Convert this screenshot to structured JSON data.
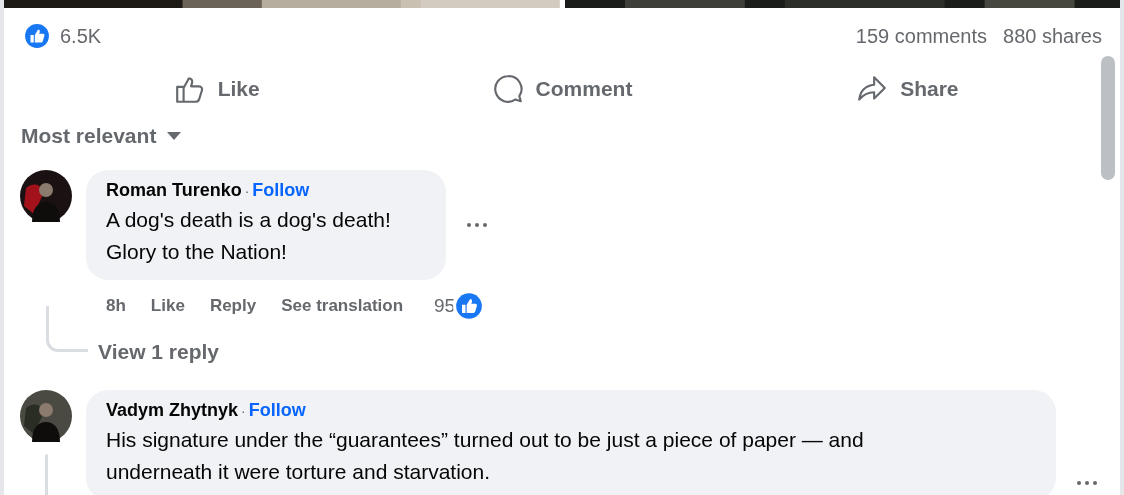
{
  "stats": {
    "reactions": "6.5K",
    "comments": "159 comments",
    "shares": "880 shares"
  },
  "actions": [
    {
      "kind": "like",
      "label": "Like"
    },
    {
      "kind": "comment",
      "label": "Comment"
    },
    {
      "kind": "share",
      "label": "Share"
    }
  ],
  "sort": {
    "label": "Most relevant"
  },
  "comments": [
    {
      "author": "Roman Turenko",
      "separator": "·",
      "follow": "Follow",
      "lines": [
        "A dog's death is a dog's death!",
        "Glory to the Nation!"
      ],
      "time": "8h",
      "like": "Like",
      "reply": "Reply",
      "translate": "See translation",
      "reaction_count": "95",
      "replies_link": "View 1 reply"
    },
    {
      "author": "Vadym Zhytnyk",
      "separator": "·",
      "follow": "Follow",
      "lines": [
        "His signature under the “guarantees” turned out to be just a piece of paper — and",
        "underneath it were torture and starvation."
      ]
    }
  ]
}
